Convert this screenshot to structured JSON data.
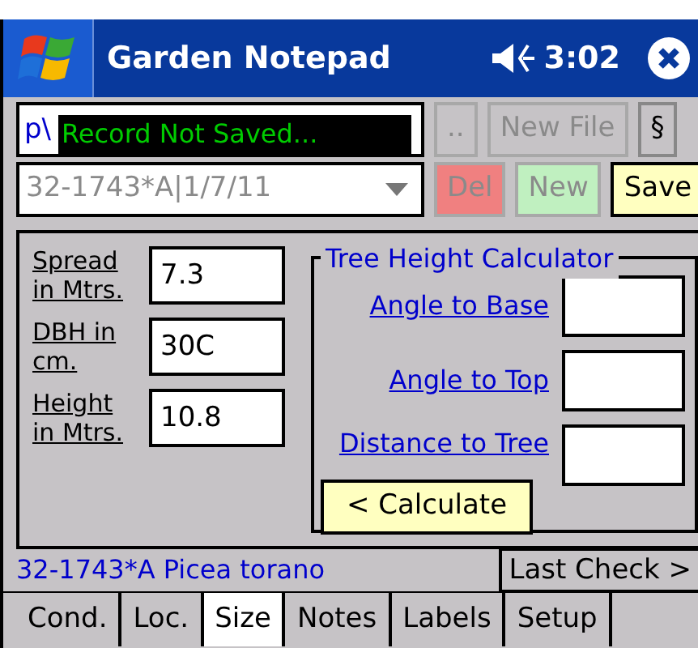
{
  "title_bar": {
    "title": "Garden Notepad",
    "time": "3:02"
  },
  "file_field": {
    "value": "p\\",
    "overlay": "Record Not Saved..."
  },
  "file_buttons": [
    {
      "label": "..",
      "disabled": true
    },
    {
      "label": "New File",
      "disabled": true
    },
    {
      "label": "§",
      "disabled": false
    }
  ],
  "record_select": {
    "value": "32-1743*A|1/7/11",
    "disabled": true
  },
  "record_buttons": [
    {
      "label": "Del",
      "kind": "delete",
      "disabled": true
    },
    {
      "label": "New",
      "kind": "new",
      "disabled": true
    },
    {
      "label": "Save",
      "kind": "save",
      "disabled": false
    }
  ],
  "measurements": [
    {
      "label": "Spread in Mtrs.",
      "value": "7.3"
    },
    {
      "label": "DBH in cm.",
      "value": "30C"
    },
    {
      "label": "Height in Mtrs.",
      "value": "10.8"
    }
  ],
  "calculator": {
    "title": "Tree Height Calculator",
    "inputs": [
      {
        "label": "Angle to Base"
      },
      {
        "label": "Angle to Top"
      },
      {
        "label": "Distance to Tree"
      }
    ],
    "button": "< Calculate"
  },
  "status": {
    "record": "32-1743*A Picea torano",
    "last_check": "Last Check >"
  },
  "tabs": [
    {
      "label": "Cond.",
      "selected": false
    },
    {
      "label": "Loc.",
      "selected": false
    },
    {
      "label": "Size",
      "selected": true
    },
    {
      "label": "Notes",
      "selected": false
    },
    {
      "label": "Labels",
      "selected": false
    },
    {
      "label": "Setup",
      "selected": false
    }
  ]
}
